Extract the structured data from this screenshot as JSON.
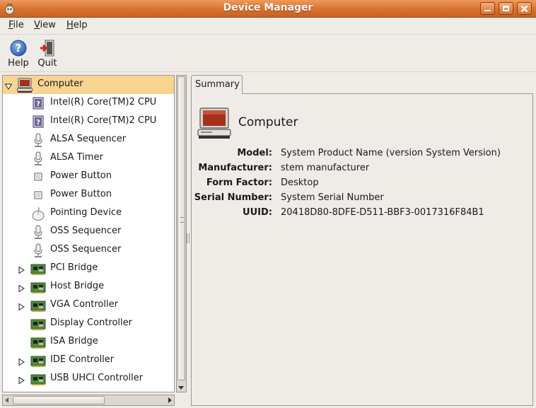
{
  "window": {
    "title": "Device Manager"
  },
  "menu": {
    "file": "File",
    "view": "View",
    "help": "Help"
  },
  "toolbar": {
    "help_label": "Help",
    "quit_label": "Quit"
  },
  "tree": {
    "items": [
      {
        "label": "Computer",
        "icon": "computer-icon",
        "expander": "expanded",
        "selected": true
      },
      {
        "label": "Intel(R) Core(TM)2 CPU",
        "icon": "cpu-icon"
      },
      {
        "label": "Intel(R) Core(TM)2 CPU",
        "icon": "cpu-icon"
      },
      {
        "label": "ALSA Sequencer",
        "icon": "microphone-icon"
      },
      {
        "label": "ALSA Timer",
        "icon": "microphone-icon"
      },
      {
        "label": "Power Button",
        "icon": "button-icon"
      },
      {
        "label": "Power Button",
        "icon": "button-icon"
      },
      {
        "label": "Pointing Device",
        "icon": "mouse-icon"
      },
      {
        "label": "OSS Sequencer",
        "icon": "microphone-icon"
      },
      {
        "label": "OSS Sequencer",
        "icon": "microphone-icon"
      },
      {
        "label": "PCI Bridge",
        "icon": "circuit-board-icon",
        "expander": "collapsed"
      },
      {
        "label": "Host Bridge",
        "icon": "circuit-board-icon",
        "expander": "collapsed"
      },
      {
        "label": "VGA Controller",
        "icon": "circuit-board-icon",
        "expander": "collapsed"
      },
      {
        "label": "Display Controller",
        "icon": "circuit-board-icon"
      },
      {
        "label": "ISA Bridge",
        "icon": "circuit-board-icon"
      },
      {
        "label": "IDE Controller",
        "icon": "circuit-board-icon",
        "expander": "collapsed"
      },
      {
        "label": "USB UHCI Controller",
        "icon": "circuit-board-icon",
        "expander": "collapsed"
      }
    ]
  },
  "summary": {
    "tab_label": "Summary",
    "title": "Computer",
    "icon": "computer-icon",
    "properties": [
      {
        "key": "Model:",
        "value": "System Product Name (version System Version)"
      },
      {
        "key": "Manufacturer:",
        "value": "stem manufacturer"
      },
      {
        "key": "Form Factor:",
        "value": "Desktop"
      },
      {
        "key": "Serial Number:",
        "value": "System Serial Number"
      },
      {
        "key": "UUID:",
        "value": "20418D80-8DFE-D511-BBF3-0017316F84B1"
      }
    ]
  },
  "colors": {
    "titlebar": "#d9712e",
    "selection": "#f7d48f",
    "window_bg": "#efebe7"
  }
}
